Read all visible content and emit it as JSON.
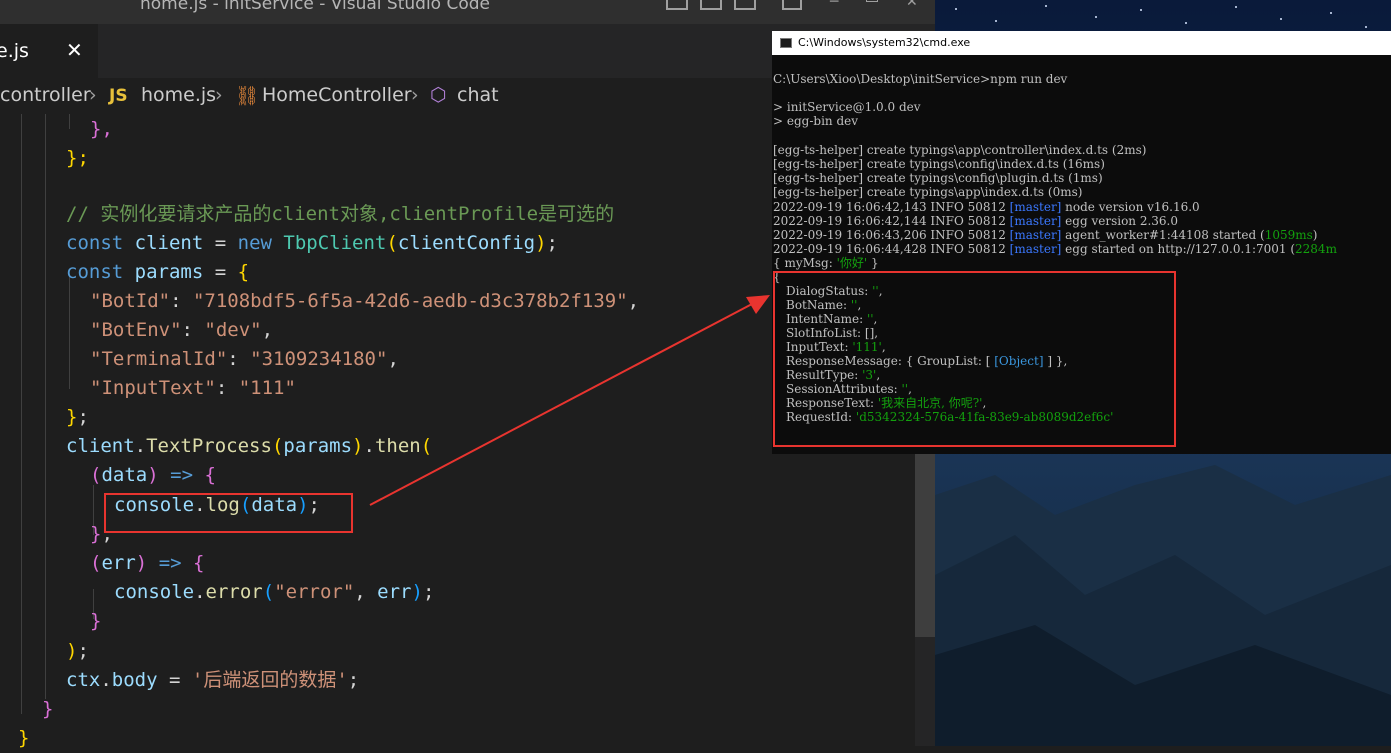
{
  "vscode": {
    "window_title": "home.js - initService - Visual Studio Code",
    "tab": {
      "name": "e.js",
      "close": "✕"
    },
    "breadcrumb": {
      "controller": "controller",
      "js_badge": "JS",
      "file": "home.js",
      "class_name": "HomeController",
      "method": "chat"
    },
    "code_lines": {
      "l1": "},",
      "l2": "};",
      "comment": "// 实例化要请求产品的client对象,clientProfile是可选的",
      "const_kw": "const",
      "client_var": "client",
      "eq": " = ",
      "new_kw": "new",
      "tbp": "TbpClient",
      "client_config": "clientConfig",
      "params_var": "params",
      "open_brace": "{",
      "botid_key": "\"BotId\"",
      "botid_val": "\"7108bdf5-6f5a-42d6-aedb-d3c378b2f139\"",
      "botenv_key": "\"BotEnv\"",
      "botenv_val": "\"dev\"",
      "terminal_key": "\"TerminalId\"",
      "terminal_val": "\"3109234180\"",
      "input_key": "\"InputText\"",
      "input_val": "\"111\"",
      "client_ref": "client",
      "textprocess": "TextProcess",
      "then": "then",
      "data_param": "data",
      "arrow": "=>",
      "console": "console",
      "log": "log",
      "error_fn": "error",
      "err_param": "err",
      "error_str": "\"error\"",
      "ctx": "ctx",
      "body": "body",
      "body_val": "'后端返回的数据'"
    }
  },
  "cmd": {
    "title": "C:\\Windows\\system32\\cmd.exe",
    "lines": [
      "C:\\Users\\Xioo\\Desktop\\initService>npm run dev",
      "> initService@1.0.0 dev",
      "> egg-bin dev",
      "[egg-ts-helper] create typings\\app\\controller\\index.d.ts (2ms)",
      "[egg-ts-helper] create typings\\config\\index.d.ts (16ms)",
      "[egg-ts-helper] create typings\\config\\plugin.d.ts (1ms)",
      "[egg-ts-helper] create typings\\app\\index.d.ts (0ms)"
    ],
    "logs": [
      {
        "prefix": "2022-09-19 16:06:42,143 INFO 50812 ",
        "tag": "[master]",
        "msg": " node version v16.16.0",
        "extra": ""
      },
      {
        "prefix": "2022-09-19 16:06:42,144 INFO 50812 ",
        "tag": "[master]",
        "msg": " egg version 2.36.0",
        "extra": ""
      },
      {
        "prefix": "2022-09-19 16:06:43,206 INFO 50812 ",
        "tag": "[master]",
        "msg": " agent_worker#1:44108 started (",
        "extra": "1059ms"
      },
      {
        "prefix": "2022-09-19 16:06:44,428 INFO 50812 ",
        "tag": "[master]",
        "msg": " egg started on http://127.0.0.1:7001 (",
        "extra": "2284m"
      }
    ],
    "mymsg": {
      "pre": "{ myMsg: ",
      "val": "'你好'",
      "post": " }"
    },
    "open_brace": "{",
    "fields": {
      "dialog_status": {
        "key": "DialogStatus: ",
        "val": "''",
        "post": ","
      },
      "bot_name": {
        "key": "BotName: ",
        "val": "''",
        "post": ","
      },
      "intent_name": {
        "key": "IntentName: ",
        "val": "''",
        "post": ","
      },
      "slot_info": {
        "key": "SlotInfoList: [],",
        "val": "",
        "post": ""
      },
      "input_text": {
        "key": "InputText: ",
        "val": "'111'",
        "post": ","
      },
      "response_message": {
        "key": "ResponseMessage: { GroupList: [ ",
        "val": "[Object]",
        "post": " ] },"
      },
      "result_type": {
        "key": "ResultType: ",
        "val": "'3'",
        "post": ","
      },
      "session_attributes": {
        "key": "SessionAttributes: ",
        "val": "''",
        "post": ","
      },
      "response_text": {
        "key": "ResponseText: ",
        "val": "'我来自北京, 你呢?'",
        "post": ","
      },
      "request_id": {
        "key": "RequestId: ",
        "val": "'d5342324-576a-41fa-83e9-ab8089d2ef6c'",
        "post": ""
      }
    }
  },
  "colors": {
    "annotation": "#e8342f",
    "keyword": "#569cd6",
    "string": "#ce9178",
    "comment": "#6a9955"
  }
}
